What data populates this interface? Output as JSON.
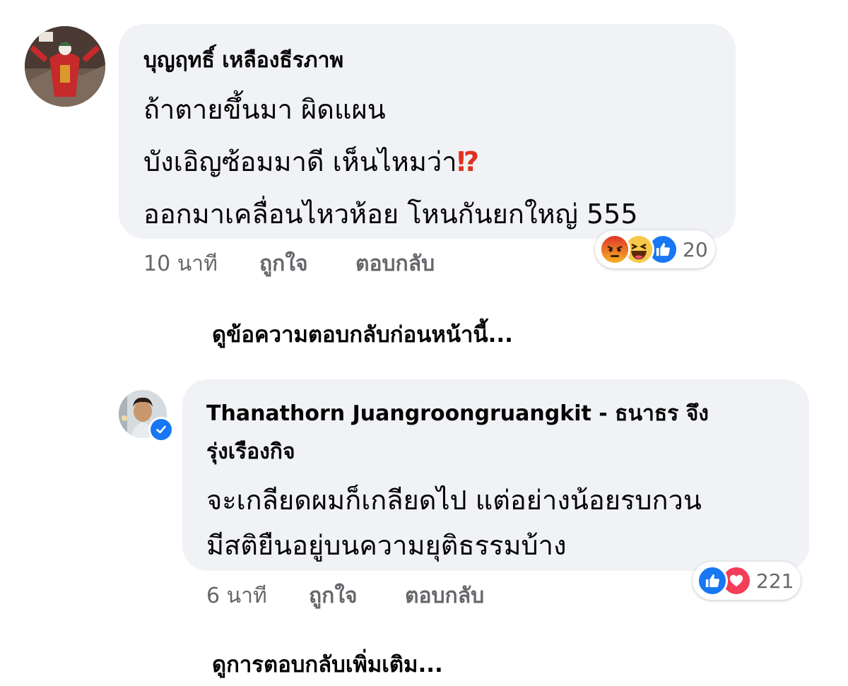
{
  "comment1": {
    "author": "บุญฤทธิ์ เหลืองธีรภาพ",
    "lines": [
      "ถ้าตายขึ้นมา ผิดแผน",
      "บังเอิญซ้อมมาดี เห็นไหมว่า",
      "ออกมาเคลื่อนไหวห้อย โหนกันยกใหญ่ 555"
    ],
    "interrobang": "⁉",
    "time": "10 นาที",
    "like_label": "ถูกใจ",
    "reply_label": "ตอบกลับ",
    "reactions": [
      "angry-icon",
      "haha-icon",
      "like-icon"
    ],
    "reaction_count": "20"
  },
  "view_previous_replies": "ดูข้อความตอบกลับก่อนหน้านี้...",
  "comment2": {
    "author_line1": "Thanathorn Juangroongruangkit - ธนาธร จึง",
    "author_line2": "รุ่งเรืองกิจ",
    "lines": [
      "จะเกลียดผมก็เกลียดไป แต่อย่างน้อยรบกวน",
      "มีสติยืนอยู่บนความยุติธรรมบ้าง"
    ],
    "verified_badge": "verified-badge-icon",
    "time": "6 นาที",
    "like_label": "ถูกใจ",
    "reply_label": "ตอบกลับ",
    "reactions": [
      "like-icon",
      "love-icon"
    ],
    "reaction_count": "221"
  },
  "view_more_replies": "ดูการตอบกลับเพิ่มเติม...",
  "colors": {
    "bubble": "#f0f2f5",
    "meta_text": "#65676b",
    "like_blue": "#1877f2",
    "love_red": "#f33e58",
    "emoji_yellow": "#f7b125",
    "angry_orange": "#e9710f"
  }
}
